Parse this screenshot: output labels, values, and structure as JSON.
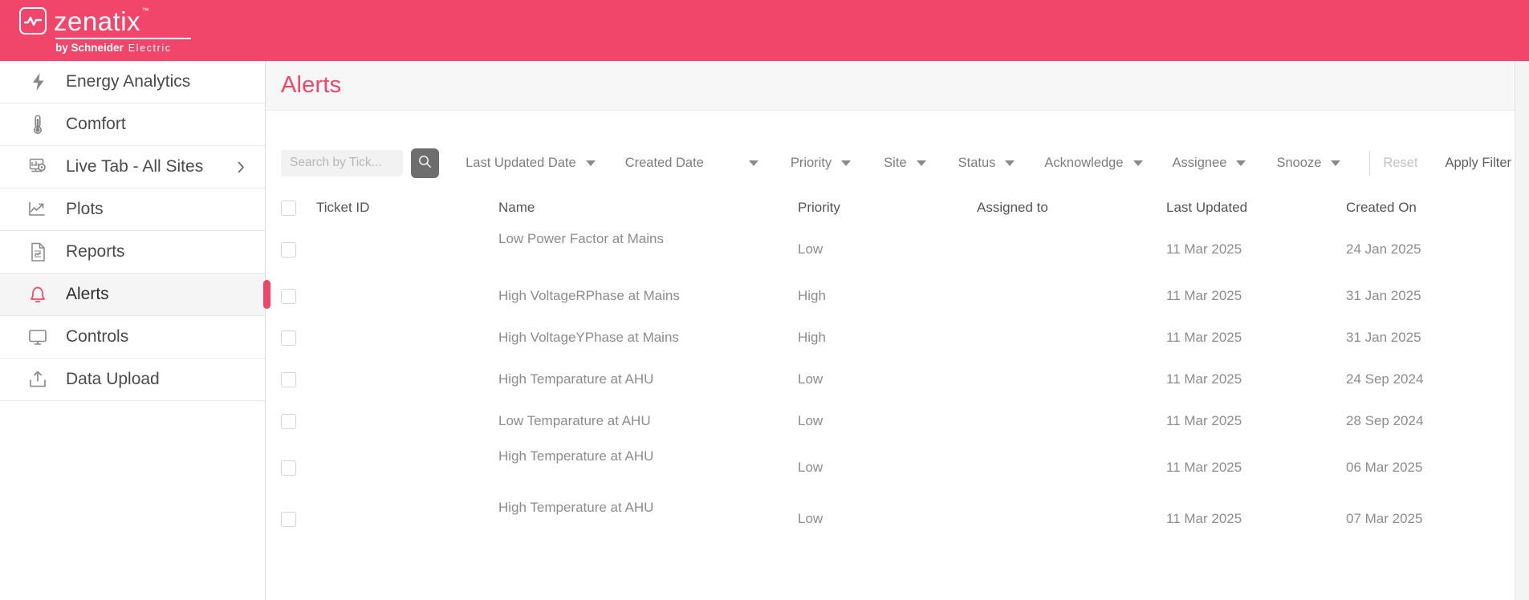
{
  "brand": {
    "name": "zenatix",
    "trademark": "™",
    "byline_bold": "by Schneider",
    "byline_light": "Electric",
    "logo_icon": "waveform-square-icon",
    "header_color": "#f2456a"
  },
  "sidebar": {
    "items": [
      {
        "label": "Energy Analytics",
        "icon": "bolt-icon",
        "active": false,
        "has_chevron": false
      },
      {
        "label": "Comfort",
        "icon": "thermometer-icon",
        "active": false,
        "has_chevron": false
      },
      {
        "label": "Live Tab - All Sites",
        "icon": "live-monitor-icon",
        "active": false,
        "has_chevron": true
      },
      {
        "label": "Plots",
        "icon": "line-chart-icon",
        "active": false,
        "has_chevron": false
      },
      {
        "label": "Reports",
        "icon": "report-doc-icon",
        "active": false,
        "has_chevron": false
      },
      {
        "label": "Alerts",
        "icon": "bell-icon",
        "active": true,
        "has_chevron": false
      },
      {
        "label": "Controls",
        "icon": "monitor-icon",
        "active": false,
        "has_chevron": false
      },
      {
        "label": "Data Upload",
        "icon": "upload-icon",
        "active": false,
        "has_chevron": false
      }
    ]
  },
  "page": {
    "title": "Alerts",
    "title_color": "#f2456a"
  },
  "filters": {
    "search": {
      "value": "",
      "placeholder": "Search by Tick..."
    },
    "search_button_icon": "search-icon",
    "dropdowns": [
      {
        "label": "Last Updated Date"
      },
      {
        "label": "Created Date"
      },
      {
        "label": "Priority"
      },
      {
        "label": "Site"
      },
      {
        "label": "Status"
      },
      {
        "label": "Acknowledge"
      },
      {
        "label": "Assignee"
      },
      {
        "label": "Snooze"
      }
    ],
    "reset_label": "Reset",
    "apply_label": "Apply Filter"
  },
  "table": {
    "columns": [
      "Ticket ID",
      "Name",
      "Priority",
      "Assigned to",
      "Last Updated",
      "Created On"
    ],
    "rows": [
      {
        "ticket_id": "",
        "name": "Low Power Factor at Mains",
        "priority": "Low",
        "assigned_to": "",
        "last_updated": "11 Mar 2025",
        "created_on": "24 Jan 2025",
        "tall": true
      },
      {
        "ticket_id": "",
        "name": "High VoltageRPhase at Mains",
        "priority": "High",
        "assigned_to": "",
        "last_updated": "11 Mar 2025",
        "created_on": "31 Jan 2025",
        "tall": false
      },
      {
        "ticket_id": "",
        "name": "High VoltageYPhase at Mains",
        "priority": "High",
        "assigned_to": "",
        "last_updated": "11 Mar 2025",
        "created_on": "31 Jan 2025",
        "tall": false
      },
      {
        "ticket_id": "",
        "name": "High Temparature at AHU",
        "priority": "Low",
        "assigned_to": "",
        "last_updated": "11 Mar 2025",
        "created_on": "24 Sep 2024",
        "tall": false
      },
      {
        "ticket_id": "",
        "name": "Low Temparature at AHU",
        "priority": "Low",
        "assigned_to": "",
        "last_updated": "11 Mar 2025",
        "created_on": "28 Sep 2024",
        "tall": false
      },
      {
        "ticket_id": "",
        "name": "High Temperature at AHU",
        "priority": "Low",
        "assigned_to": "",
        "last_updated": "11 Mar 2025",
        "created_on": "06 Mar 2025",
        "tall": true
      },
      {
        "ticket_id": "",
        "name": "High Temperature at AHU",
        "priority": "Low",
        "assigned_to": "",
        "last_updated": "11 Mar 2025",
        "created_on": "07 Mar 2025",
        "tall": true
      }
    ]
  }
}
